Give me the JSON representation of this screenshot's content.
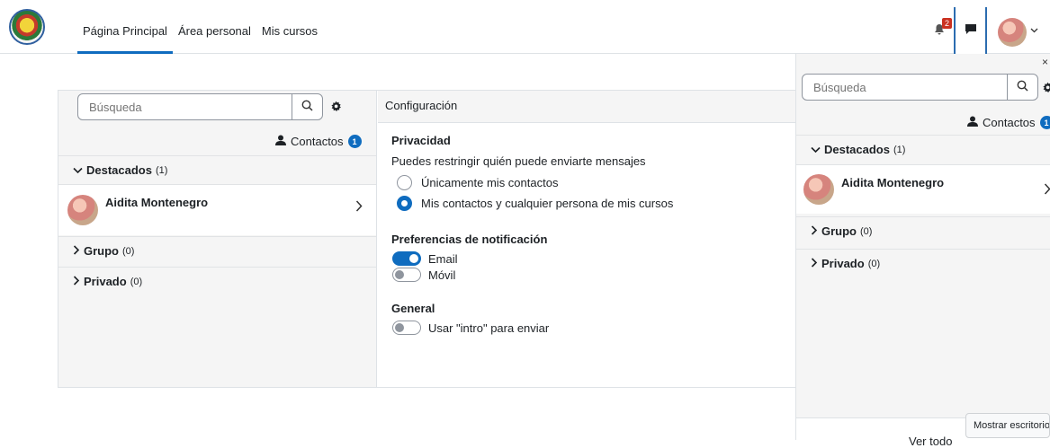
{
  "nav": {
    "items": [
      {
        "label": "Página Principal"
      },
      {
        "label": "Área personal"
      },
      {
        "label": "Mis cursos"
      }
    ],
    "notification_count": "2"
  },
  "messages": {
    "search_placeholder": "Búsqueda",
    "contacts_label": "Contactos",
    "contacts_count": "1",
    "sections": {
      "starred": {
        "label": "Destacados",
        "count": "(1)"
      },
      "group": {
        "label": "Grupo",
        "count": "(0)"
      },
      "private": {
        "label": "Privado",
        "count": "(0)"
      }
    },
    "contacts": [
      {
        "name": "Aidita Montenegro"
      }
    ]
  },
  "settings": {
    "header": "Configuración",
    "privacy_title": "Privacidad",
    "privacy_desc": "Puedes restringir quién puede enviarte mensajes",
    "options": [
      {
        "label": "Únicamente mis contactos",
        "checked": false
      },
      {
        "label": "Mis contactos y cualquier persona de mis cursos",
        "checked": true
      }
    ],
    "notif_title": "Preferencias de notificación",
    "notif": [
      {
        "label": "Email",
        "on": true
      },
      {
        "label": "Móvil",
        "on": false
      }
    ],
    "general_title": "General",
    "general": [
      {
        "label": "Usar \"intro\" para enviar",
        "on": false
      }
    ]
  },
  "drawer": {
    "close": "×",
    "see_all": "Ver todo",
    "tooltip": "Mostrar escritorio"
  },
  "colors": {
    "accent": "#0f6cbf",
    "badge": "#ca3120"
  }
}
